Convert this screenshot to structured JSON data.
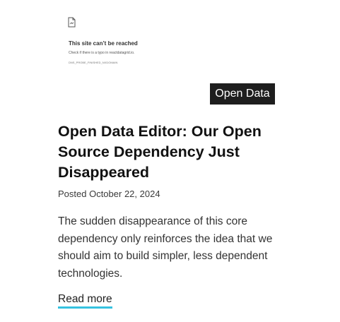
{
  "thumbnail": {
    "icon": "broken-document-icon",
    "error_title": "This site can’t be reached",
    "error_subtitle": "Check if there is a typo in reactdatagrid.io.",
    "error_code": "DNS_PROBE_FINISHED_NXDOMAIN"
  },
  "post": {
    "category_tag": "Open Data",
    "title": "Open Data Editor: Our Open Source Dependency Just Disappeared",
    "posted": "Posted October 22, 2024",
    "excerpt": "The sudden disappearance of this core dependency only reinforces the idea that we should aim to build simpler, less dependent technologies.",
    "read_more_label": "Read more"
  },
  "colors": {
    "tag_background": "#1e1e1e",
    "link_underline": "#35c2e0"
  }
}
